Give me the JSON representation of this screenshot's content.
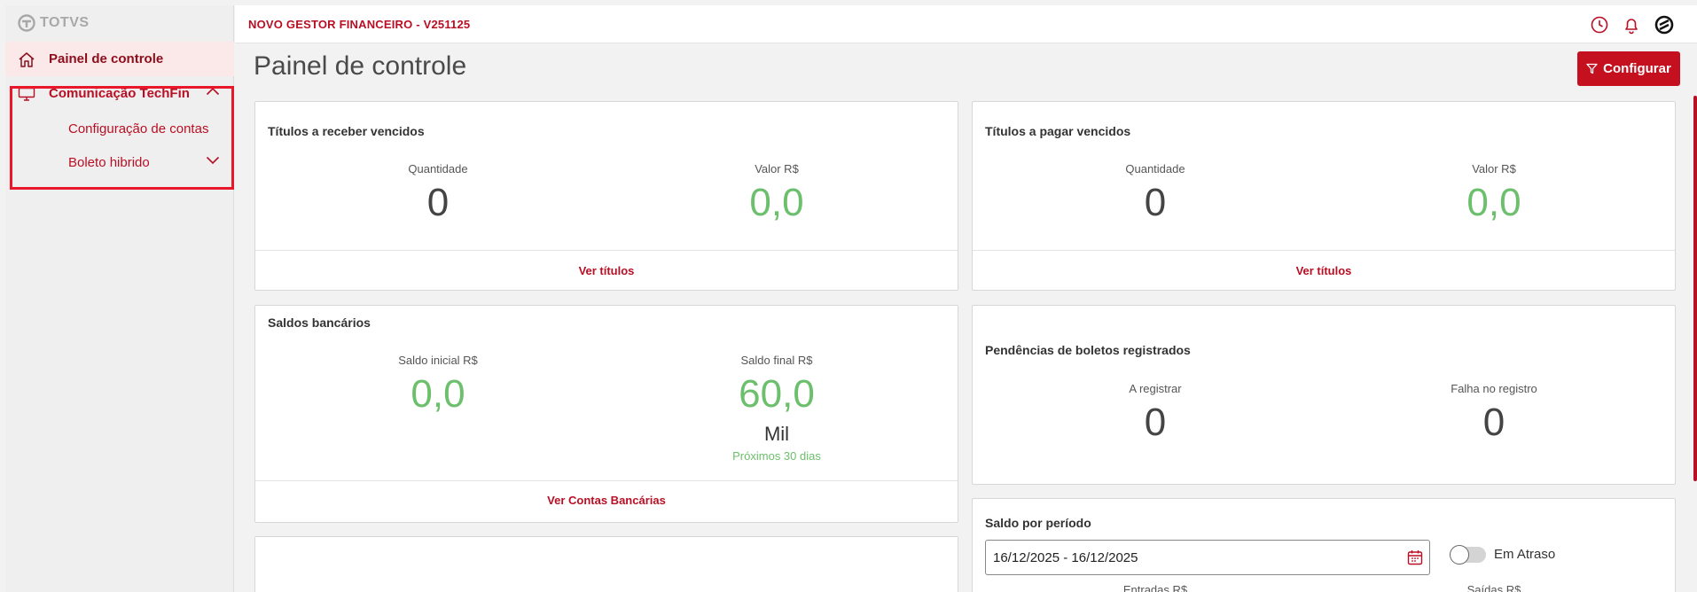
{
  "brand": {
    "logo_text": "TOTVS"
  },
  "sidebar": {
    "items": [
      {
        "label": "Painel de controle"
      },
      {
        "label": "Comunicação TechFin"
      },
      {
        "label": "Configuração de contas"
      },
      {
        "label": "Boleto hibrido"
      }
    ]
  },
  "header": {
    "title": "NOVO GESTOR FINANCEIRO - V251125"
  },
  "main": {
    "title": "Painel de controle",
    "configure_label": "Configurar",
    "cards": {
      "receber": {
        "title": "Títulos a receber vencidos",
        "qty_label": "Quantidade",
        "qty": "0",
        "value_label": "Valor R$",
        "value": "0,0",
        "link": "Ver títulos"
      },
      "pagar": {
        "title": "Títulos a pagar vencidos",
        "qty_label": "Quantidade",
        "qty": "0",
        "value_label": "Valor R$",
        "value": "0,0",
        "link": "Ver títulos"
      },
      "saldos": {
        "title": "Saldos bancários",
        "initial_label": "Saldo inicial R$",
        "initial": "0,0",
        "final_label": "Saldo final R$",
        "final": "60,0",
        "final_unit": "Mil",
        "final_note": "Próximos 30 dias",
        "link": "Ver Contas Bancárias"
      },
      "pendencias": {
        "title": "Pendências de boletos registrados",
        "a_registrar_label": "A registrar",
        "a_registrar": "0",
        "falha_label": "Falha no registro",
        "falha": "0"
      },
      "periodo": {
        "title": "Saldo por período",
        "date_range": "16/12/2025 - 16/12/2025",
        "toggle_label": "Em Atraso",
        "entradas_label": "Entradas R$",
        "saidas_label": "Saídas R$"
      }
    }
  },
  "colors": {
    "brand_red": "#b80f24",
    "button_red": "#c5101f",
    "value_green": "#6cbf6c"
  },
  "icons": [
    "totvs-logo-icon",
    "home-icon",
    "monitor-icon",
    "chevron-up-icon",
    "chevron-down-icon",
    "clock-icon",
    "bell-icon",
    "totvs-badge-icon",
    "filter-icon",
    "calendar-icon"
  ]
}
